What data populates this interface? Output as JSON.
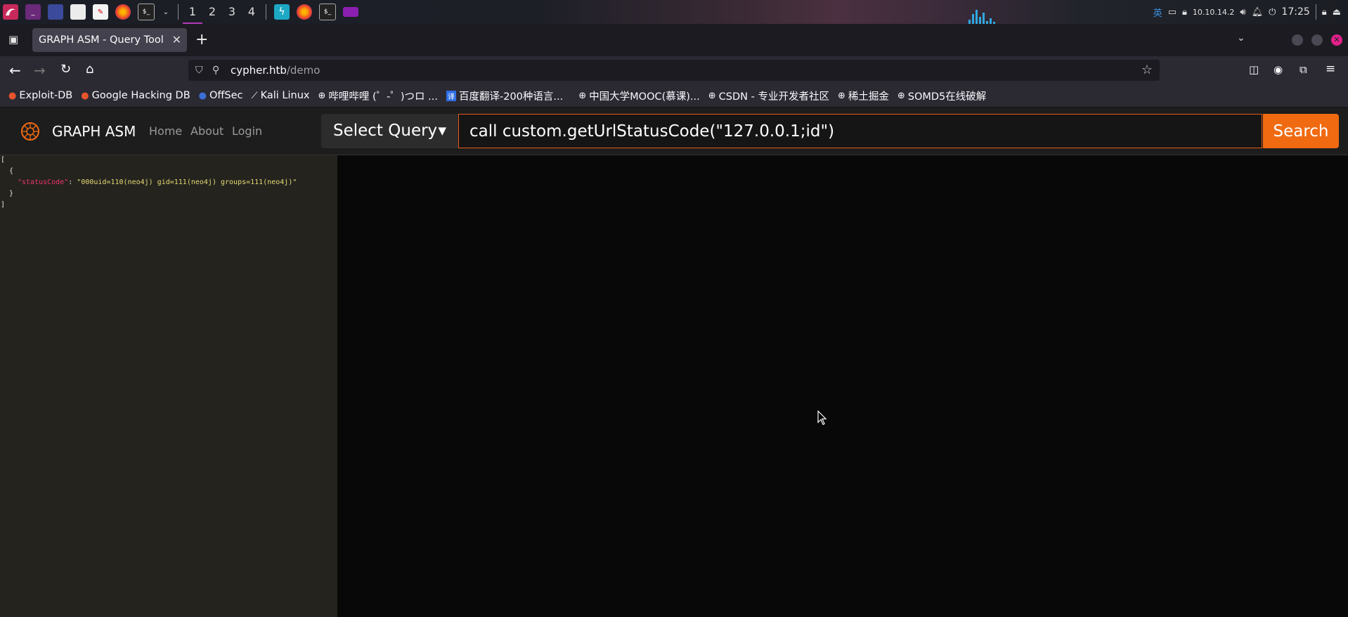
{
  "os_panel": {
    "workspaces": [
      "1",
      "2",
      "3",
      "4"
    ],
    "ime": "英",
    "ip": "10.10.14.2",
    "time": "17:25"
  },
  "browser": {
    "tab_title": "GRAPH ASM - Query Tool",
    "url_host": "cypher.htb",
    "url_path": "/demo",
    "bookmarks": [
      "Exploit-DB",
      "Google Hacking DB",
      "OffSec",
      "Kali Linux",
      "哔哩哔哩 (゜-゜)つロ ...",
      "百度翻译-200种语言...",
      "中国大学MOOC(慕课)...",
      "CSDN - 专业开发者社区",
      "稀土掘金",
      "SOMD5在线破解"
    ]
  },
  "site": {
    "brand": "GRAPH ASM",
    "nav": [
      "Home",
      "About",
      "Login"
    ],
    "select_label": "Select Query",
    "query_value": "call custom.getUrlStatusCode(\"127.0.0.1;id\")",
    "search_label": "Search"
  },
  "result": {
    "open_bracket": "[",
    "open_brace": "{",
    "key": "\"statusCode\"",
    "colon": ": ",
    "value": "\"000uid=110(neo4j) gid=111(neo4j) groups=111(neo4j)\"",
    "close_brace": "}",
    "close_bracket": "]"
  },
  "colors": {
    "accent": "#f06a11",
    "result_bg": "#24231e",
    "json_key": "#f0366d",
    "json_string": "#e6db74"
  }
}
